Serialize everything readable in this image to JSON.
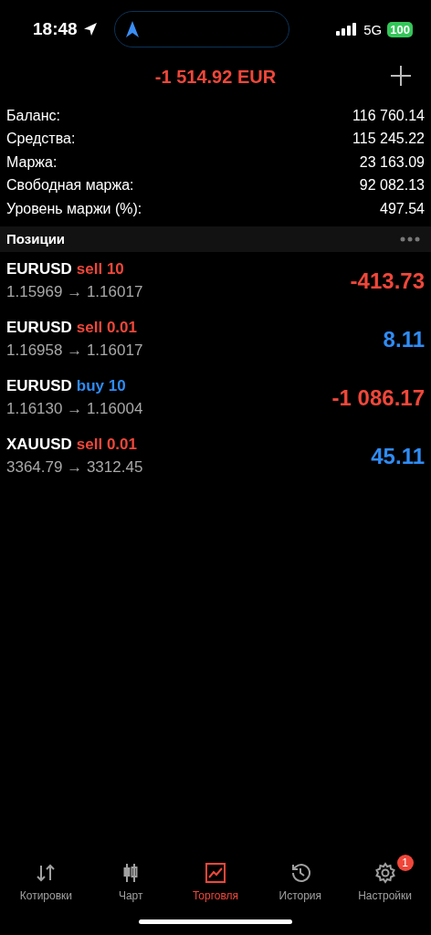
{
  "status_bar": {
    "time": "18:48",
    "network": "5G",
    "battery": "100"
  },
  "header": {
    "total": "-1 514.92 EUR",
    "color": "#f0473a"
  },
  "summary": [
    {
      "label": "Баланс:",
      "value": "116 760.14"
    },
    {
      "label": "Средства:",
      "value": "115 245.22"
    },
    {
      "label": "Маржа:",
      "value": "23 163.09"
    },
    {
      "label": "Свободная маржа:",
      "value": "92 082.13"
    },
    {
      "label": "Уровень маржи (%):",
      "value": "497.54"
    }
  ],
  "section": {
    "title": "Позиции"
  },
  "positions": [
    {
      "symbol": "EURUSD",
      "order": {
        "text": "sell 10",
        "color": "#f0473a"
      },
      "prices": "1.15969 → 1.16017",
      "profit": "-413.73",
      "color": "#f0473a"
    },
    {
      "symbol": "EURUSD",
      "order": {
        "text": "sell 0.01",
        "color": "#f0473a"
      },
      "prices": "1.16958 → 1.16017",
      "profit": "8.11",
      "color": "#2f8cf5"
    },
    {
      "symbol": "EURUSD",
      "order": {
        "text": "buy 10",
        "color": "#2f8cf5"
      },
      "prices": "1.16130 → 1.16004",
      "profit": "-1 086.17",
      "color": "#f0473a"
    },
    {
      "symbol": "XAUUSD",
      "order": {
        "text": "sell 0.01",
        "color": "#f0473a"
      },
      "prices": "3364.79 → 3312.45",
      "profit": "45.11",
      "color": "#2f8cf5"
    }
  ],
  "tabs": [
    {
      "label": "Котировки",
      "kind": "quotes",
      "selected": false
    },
    {
      "label": "Чарт",
      "kind": "chart",
      "selected": false
    },
    {
      "label": "Торговля",
      "kind": "trade",
      "selected": true
    },
    {
      "label": "История",
      "kind": "history",
      "selected": false
    },
    {
      "label": "Настройки",
      "kind": "settings",
      "selected": false,
      "badge": "1"
    }
  ]
}
